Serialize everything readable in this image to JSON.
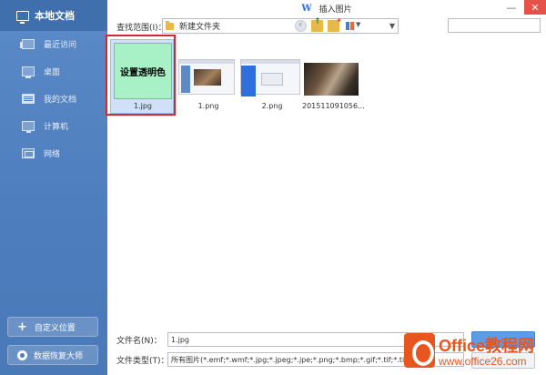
{
  "window": {
    "app_badge": "W",
    "title": "插入图片"
  },
  "sidebar": {
    "header": "本地文档",
    "items": [
      {
        "label": "最近访问",
        "icon": "clock-icon"
      },
      {
        "label": "桌面",
        "icon": "desktop-icon"
      },
      {
        "label": "我的文档",
        "icon": "documents-icon"
      },
      {
        "label": "计算机",
        "icon": "computer-icon"
      },
      {
        "label": "网络",
        "icon": "network-icon"
      }
    ],
    "custom_location": "自定义位置",
    "data_recovery": "数据恢复大师"
  },
  "toolbar": {
    "lookin_label": "查找范围(I)：",
    "lookin_value": "新建文件夹"
  },
  "files": [
    {
      "name": "1.jpg",
      "preview_text": "设置透明色",
      "selected": true
    },
    {
      "name": "1.png"
    },
    {
      "name": "2.png"
    },
    {
      "name": "201511091056..."
    }
  ],
  "form": {
    "filename_label": "文件名(N)：",
    "filename_value": "1.jpg",
    "filetype_label": "文件类型(T)：",
    "filetype_value": "所有图片(*.emf;*.wmf;*.jpg;*.jpeg;*.jpe;*.png;*.bmp;*.gif;*.tif;*.tiff;*.wdp)"
  },
  "watermark": {
    "brand": "Office教程网",
    "url": "www.office26.com"
  },
  "colors": {
    "sidebar": "#4d7dbd",
    "selection_outline": "#d9272e",
    "preview_green": "#a8f0c6",
    "close": "#e6524a"
  }
}
